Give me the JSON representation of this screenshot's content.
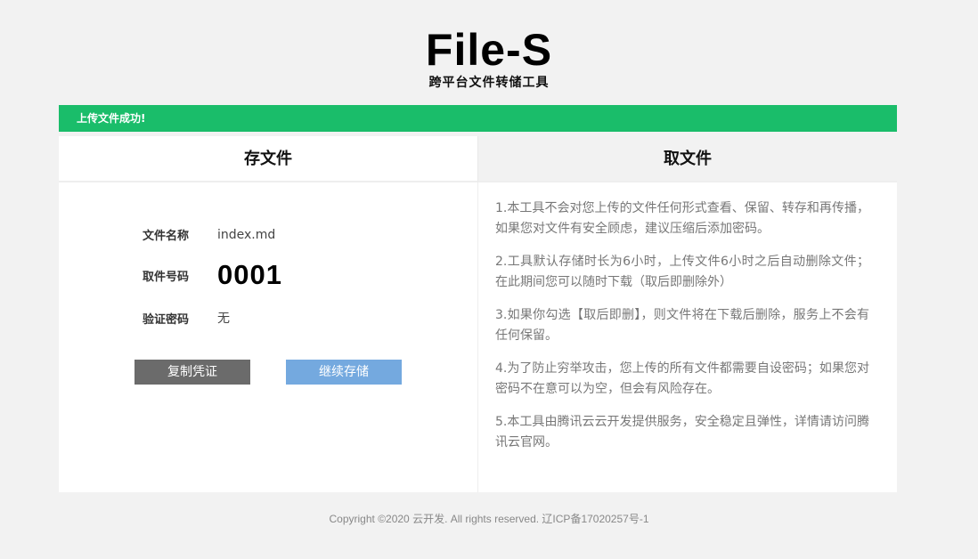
{
  "header": {
    "logo": "File-S",
    "subtitle": "跨平台文件转储工具"
  },
  "alert": {
    "message": "上传文件成功!"
  },
  "tabs": [
    {
      "label": "存文件",
      "active": true
    },
    {
      "label": "取文件",
      "active": false
    }
  ],
  "result": {
    "file_name_label": "文件名称",
    "file_name_value": "index.md",
    "code_label": "取件号码",
    "code_value": "0001",
    "password_label": "验证密码",
    "password_value": "无"
  },
  "buttons": {
    "copy_label": "复制凭证",
    "continue_label": "继续存储"
  },
  "notes": [
    "1.本工具不会对您上传的文件任何形式查看、保留、转存和再传播，如果您对文件有安全顾虑，建议压缩后添加密码。",
    "2.工具默认存储时长为6小时，上传文件6小时之后自动删除文件；在此期间您可以随时下载（取后即删除外）",
    "3.如果你勾选【取后即删】，则文件将在下载后删除，服务上不会有任何保留。",
    "4.为了防止穷举攻击，您上传的所有文件都需要自设密码；如果您对密码不在意可以为空，但会有风险存在。",
    "5.本工具由腾讯云云开发提供服务，安全稳定且弹性，详情请访问腾讯云官网。"
  ],
  "footer": {
    "text": "Copyright ©2020 云开发. All rights reserved. 辽ICP备17020257号-1"
  },
  "colors": {
    "alert_green": "#1abd6a",
    "copy_button": "#6b6b6b",
    "continue_button": "#74a9df",
    "background": "#f2f2f2"
  }
}
